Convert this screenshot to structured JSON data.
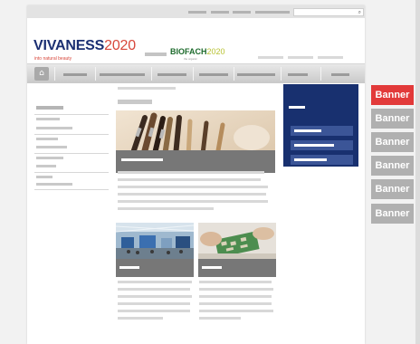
{
  "header": {
    "logo_vivaness_main": "VIVANESS",
    "logo_vivaness_year": "2020",
    "logo_vivaness_tagline": "into natural beauty",
    "logo_biofach_main": "BIOFACH",
    "logo_biofach_year": "2020",
    "logo_biofach_tagline": "the organic"
  },
  "search": {
    "icon": "search-icon"
  },
  "nav": {
    "home_icon": "home-icon",
    "home_glyph": "⌂"
  },
  "banners": [
    {
      "label": "Banner",
      "color": "#e23a3a"
    },
    {
      "label": "Banner",
      "color": "#b0b0b0"
    },
    {
      "label": "Banner",
      "color": "#b0b0b0"
    },
    {
      "label": "Banner",
      "color": "#b0b0b0"
    },
    {
      "label": "Banner",
      "color": "#b0b0b0"
    },
    {
      "label": "Banner",
      "color": "#b0b0b0"
    }
  ],
  "colors": {
    "brand_navy": "#1b2f72",
    "brand_red": "#d8473b",
    "biofach_green": "#1e6b2d",
    "teaser_box": "#18306f",
    "caption_gray": "#777777"
  }
}
